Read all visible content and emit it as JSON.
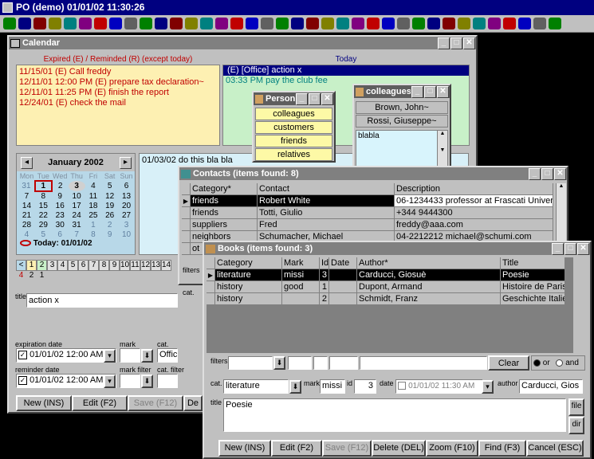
{
  "app": {
    "title": "PO (demo) 01/01/02 11:30:26",
    "toolbar_icons": [
      "check-icon",
      "phone-icon",
      "arrow-icon",
      "globe-icon",
      "person-icon",
      "search-doc-icon",
      "books-icon",
      "phone-book-icon",
      "monitor-icon",
      "pin-icon",
      "bank-icon",
      "smile-icon",
      "hourglass-icon",
      "calendar-icon",
      "grid-icon",
      "heart-icon",
      "bulb-icon",
      "key-icon",
      "clipboard-icon",
      "package-icon",
      "calc-icon",
      "au-icon",
      "list-icon",
      "binoculars-icon",
      "table-icon",
      "photo-icon",
      "network-icon",
      "book-icon",
      "monitor2-icon",
      "chart-icon",
      "phone2-icon",
      "box-icon",
      "folder-icon",
      "cube-icon",
      "help-icon",
      "tools-icon",
      "window-icon"
    ]
  },
  "calendar": {
    "title": "Calendar",
    "expired_header": "Expired (E) / Reminded (R) (except today)",
    "today_header": "Today",
    "expired_items": [
      "11/15/01 (E) Call freddy",
      "12/11/01 12:00 PM (E) prepare tax declaration~",
      "12/11/01 11:25 PM (E) finish the report",
      "12/24/01 (E) check the mail"
    ],
    "today_items": [
      "(E) [Office] action x",
      "03:33 PM pay the club fee"
    ],
    "month": {
      "label": "January 2002",
      "weekdays": [
        "Mon",
        "Tue",
        "Wed",
        "Thu",
        "Fri",
        "Sat",
        "Sun"
      ],
      "weeks": [
        [
          "31",
          "1",
          "2",
          "3",
          "4",
          "5",
          "6"
        ],
        [
          "7",
          "8",
          "9",
          "10",
          "11",
          "12",
          "13"
        ],
        [
          "14",
          "15",
          "16",
          "17",
          "18",
          "19",
          "20"
        ],
        [
          "21",
          "22",
          "23",
          "24",
          "25",
          "26",
          "27"
        ],
        [
          "28",
          "29",
          "30",
          "31",
          "1",
          "2",
          "3"
        ],
        [
          "4",
          "5",
          "6",
          "7",
          "8",
          "9",
          "10"
        ]
      ],
      "today_label": "Today: 01/01/02"
    },
    "day_notes": "01/03/02 do this bla bla",
    "day_strip": [
      "<",
      "1",
      "2",
      "3",
      "4",
      "5",
      "6",
      "7",
      "8",
      "9",
      "10",
      "11",
      "12",
      "13",
      "14"
    ],
    "day_counts": [
      "4",
      "2",
      "1"
    ],
    "title_label": "title",
    "title_value": "action x",
    "expiration_label": "expiration date",
    "expiration_value": "01/01/02 12:00 AM",
    "mark_label": "mark",
    "cat_label": "cat.",
    "cat_value": "Office",
    "reminder_label": "reminder date",
    "reminder_value": "01/01/02 12:00 AM",
    "mark_filter_label": "mark filter",
    "cat_filter_label": "cat. filter",
    "buttons": {
      "new": "New (INS)",
      "edit": "Edit (F2)",
      "save": "Save (F12)",
      "del": "De"
    }
  },
  "persons": {
    "title": "Persons",
    "items": [
      "colleagues",
      "customers",
      "friends",
      "relatives"
    ]
  },
  "colleagues": {
    "title": "colleagues",
    "items": [
      "Brown, John~",
      "Rossi, Giuseppe~"
    ],
    "note": "blabla"
  },
  "contacts": {
    "title": "Contacts (items found: 8)",
    "columns": [
      "Category*",
      "Contact",
      "Description"
    ],
    "rows": [
      [
        "friends",
        "Robert White",
        "06-1234433 professor at Frascati Univer"
      ],
      [
        "friends",
        "Totti, Giulio",
        "+344 9444300"
      ],
      [
        "suppliers",
        "Fred",
        "freddy@aaa.com"
      ],
      [
        "neighbors",
        "Schumacher, Michael",
        "04-2212212 michael@schumi.com"
      ],
      [
        "ot",
        "",
        ""
      ]
    ],
    "filters_label": "filters",
    "cat_label": "cat.",
    "desc_label": "desc."
  },
  "books": {
    "title": "Books (items found: 3)",
    "columns": [
      "Category",
      "Mark",
      "Id",
      "Date",
      "Author*",
      "Title"
    ],
    "rows": [
      [
        "literature",
        "missi",
        "3",
        "",
        "Carducci, Giosuè",
        "Poesie"
      ],
      [
        "history",
        "good",
        "1",
        "",
        "Dupont, Armand",
        "Histoire de Paris"
      ],
      [
        "history",
        "",
        "2",
        "",
        "Schmidt, Franz",
        "Geschichte Italie"
      ]
    ],
    "filters_label": "filters",
    "clear_label": "Clear",
    "or_label": "or",
    "and_label": "and",
    "cat_label": "cat.",
    "cat_value": "literature",
    "mark_label": "mark",
    "mark_value": "missi",
    "id_label": "id",
    "id_value": "3",
    "date_label": "date",
    "date_value": "01/01/02 11:30 AM",
    "author_label": "author",
    "author_value": "Carducci, Gios",
    "title_label": "title",
    "title_value": "Poesie",
    "file_label": "file",
    "dir_label": "dir",
    "buttons": {
      "new": "New (INS)",
      "edit": "Edit (F2)",
      "save": "Save (F12)",
      "delete": "Delete (DEL)",
      "zoom": "Zoom (F10)",
      "find": "Find (F3)",
      "cancel": "Cancel (ESC)"
    }
  }
}
